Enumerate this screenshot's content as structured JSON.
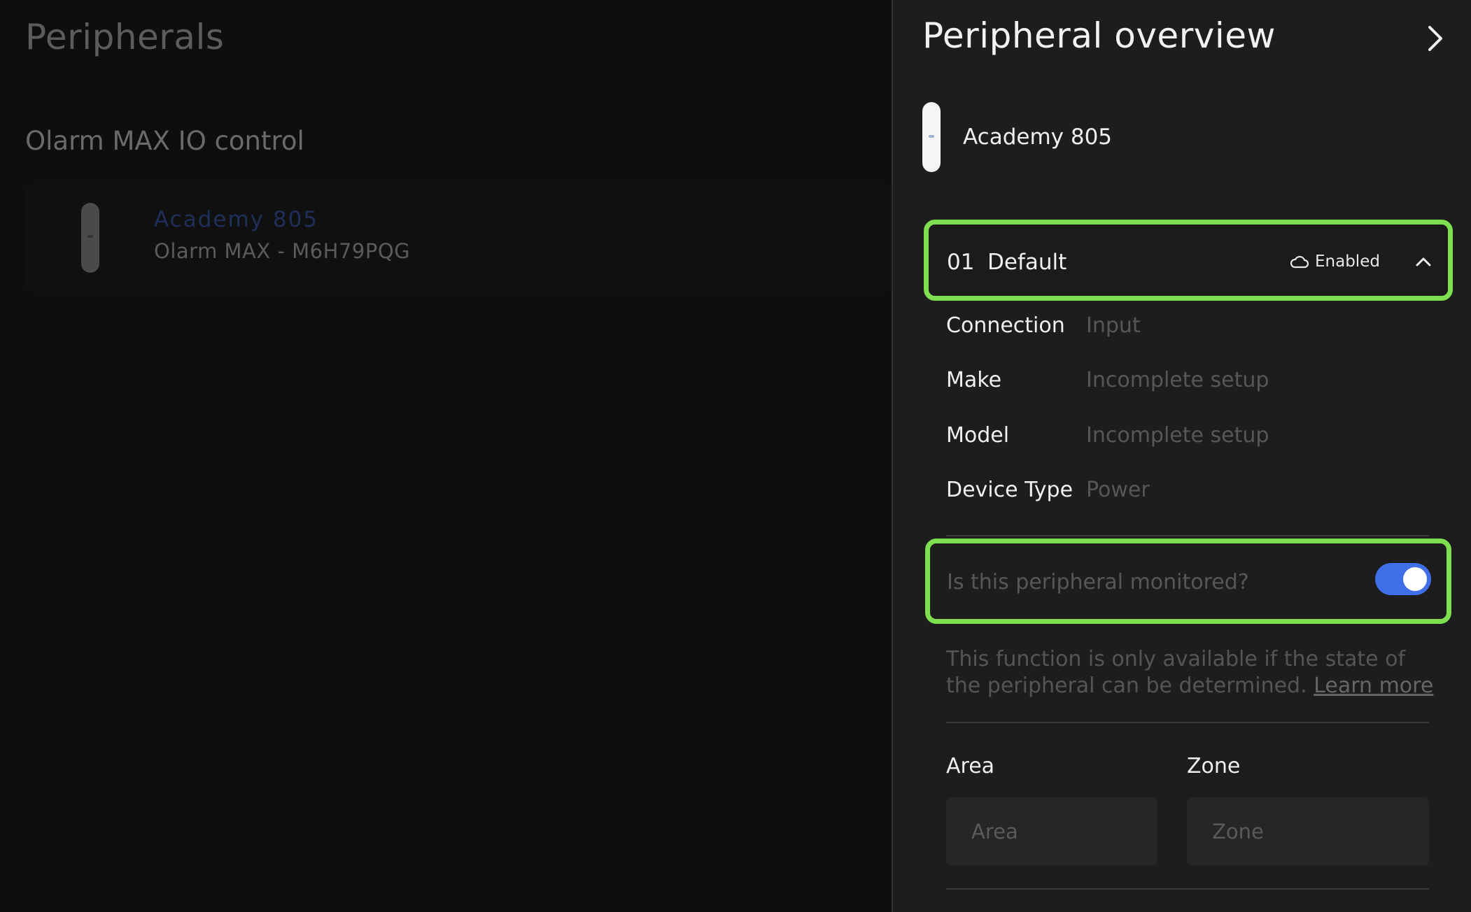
{
  "background_page": {
    "title": "Peripherals",
    "section_title": "Olarm MAX IO control",
    "device": {
      "name": "Academy 805",
      "subtitle": "Olarm MAX - M6H79PQG"
    }
  },
  "panel": {
    "title": "Peripheral overview",
    "close_icon": "chevron-right-icon",
    "device_name": "Academy 805",
    "accordion": {
      "number": "01",
      "name": "Default",
      "status": "Enabled",
      "status_icon": "cloud-icon",
      "toggle_icon": "chevron-up-icon"
    },
    "details": [
      {
        "label": "Connection",
        "value": "Input"
      },
      {
        "label": "Make",
        "value": "Incomplete setup"
      },
      {
        "label": "Model",
        "value": "Incomplete setup"
      },
      {
        "label": "Device Type",
        "value": "Power"
      }
    ],
    "monitored": {
      "label": "Is this peripheral monitored?",
      "enabled": true
    },
    "help": {
      "text": "This function is only available if the state of the peripheral can be determined.",
      "link": "Learn more"
    },
    "fields": {
      "area_label": "Area",
      "area_placeholder": "Area",
      "zone_label": "Zone",
      "zone_placeholder": "Zone"
    }
  },
  "colors": {
    "highlight": "#7ee04f",
    "toggle_on": "#3f6ee8",
    "panel_bg": "#1d1d1d",
    "page_bg": "#0e0e0e"
  }
}
